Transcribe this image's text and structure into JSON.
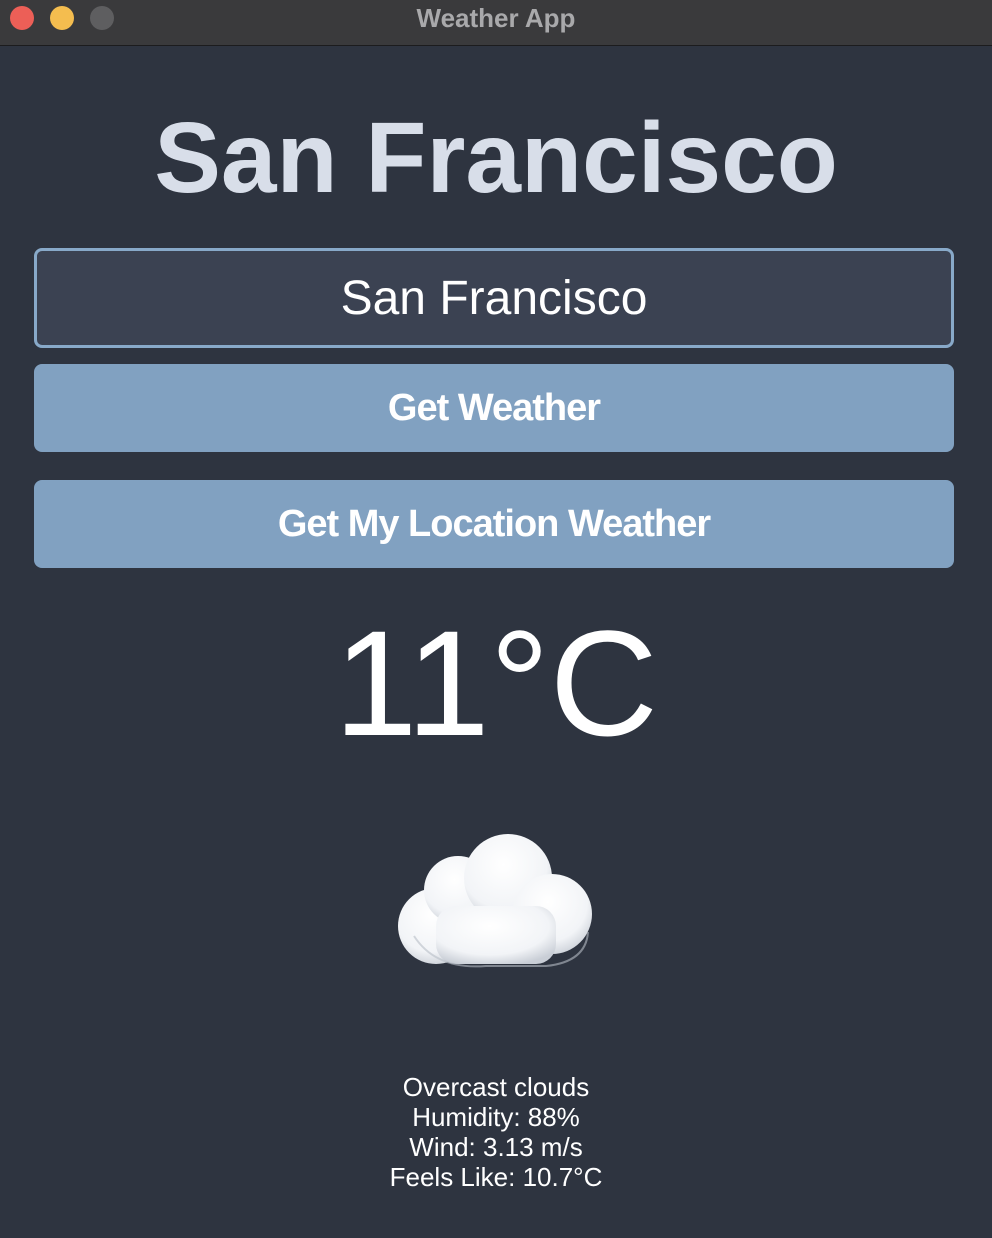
{
  "window": {
    "title": "Weather App",
    "traffic_light_colors": [
      "#ec5f57",
      "#f4bd4f",
      "#5e5e60"
    ]
  },
  "header": {
    "city": "San Francisco"
  },
  "search": {
    "value": "San Francisco"
  },
  "buttons": {
    "get_weather": "Get Weather",
    "my_location": "Get My Location Weather"
  },
  "weather": {
    "temperature": "11°C",
    "icon": "cloud-icon",
    "description": "Overcast clouds",
    "humidity": "Humidity: 88%",
    "wind": "Wind: 3.13 m/s",
    "feels_like": "Feels Like: 10.7°C"
  },
  "colors": {
    "background": "#2e3440",
    "accent": "#81a1c1",
    "input_border": "#88a9c9",
    "heading": "#d8dee9"
  }
}
